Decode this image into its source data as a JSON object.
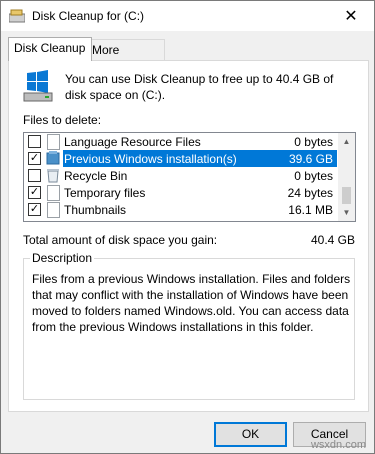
{
  "window": {
    "title": "Disk Cleanup for  (C:)"
  },
  "tabs": [
    {
      "label": "Disk Cleanup"
    },
    {
      "label": "More Options"
    }
  ],
  "intro": "You can use Disk Cleanup to free up to 40.4 GB of disk space on  (C:).",
  "files_label": "Files to delete:",
  "files": [
    {
      "name": "Language Resource Files",
      "size": "0 bytes",
      "checked": false
    },
    {
      "name": "Previous Windows installation(s)",
      "size": "39.6 GB",
      "checked": true
    },
    {
      "name": "Recycle Bin",
      "size": "0 bytes",
      "checked": false
    },
    {
      "name": "Temporary files",
      "size": "24 bytes",
      "checked": true
    },
    {
      "name": "Thumbnails",
      "size": "16.1 MB",
      "checked": true
    }
  ],
  "total": {
    "label": "Total amount of disk space you gain:",
    "value": "40.4 GB"
  },
  "description": {
    "title": "Description",
    "text": "Files from a previous Windows installation.  Files and folders that may conflict with the installation of Windows have been moved to folders named Windows.old.  You can access data from the previous Windows installations in this folder."
  },
  "buttons": {
    "ok": "OK",
    "cancel": "Cancel"
  },
  "watermark": "wsxdn.com",
  "colors": {
    "selection": "#0078d7",
    "window_bg": "#f0f0f0"
  },
  "icons": {
    "close": "✕",
    "check": "✓",
    "up": "▲",
    "down": "▼"
  }
}
